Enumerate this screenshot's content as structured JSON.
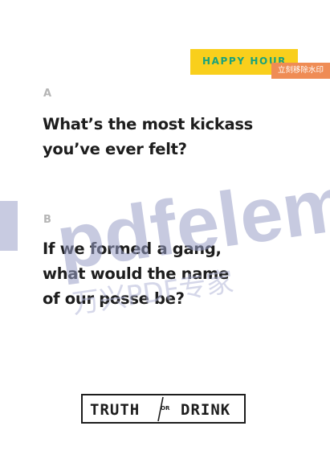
{
  "badge": {
    "label": "HAPPY HOUR"
  },
  "watermark": {
    "remove_label": "立刻移除水印",
    "brand": "pdfeleme",
    "brand_cn": "万兴PDF专家"
  },
  "questions": [
    {
      "letter": "A",
      "text": "What’s the most kickass\nyou’ve ever felt?"
    },
    {
      "letter": "B",
      "text": "If we formed a gang,\nwhat would the name\nof our posse be?"
    }
  ],
  "logo": {
    "left": "TRUTH",
    "middle": "OR",
    "right": "DRINK"
  },
  "colors": {
    "badge": "#f9cf1c",
    "badge_text": "#1aa27c",
    "removal_tag": "#ef8c55",
    "text": "#1d1d1d",
    "letter": "#b5b5b5"
  }
}
